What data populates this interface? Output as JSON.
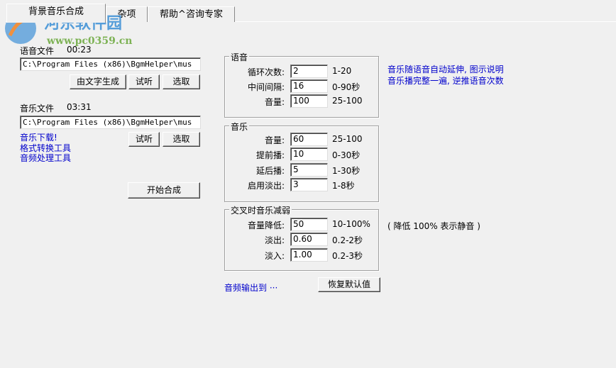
{
  "tabs": [
    {
      "label": "背景音乐合成"
    },
    {
      "label": "杂项"
    },
    {
      "label": "帮助^咨询专家"
    }
  ],
  "watermark": {
    "name": "河东软件园",
    "url": "www.pc0359.cn"
  },
  "voice_file": {
    "label": "语音文件",
    "duration": "00:23",
    "path": "C:\\Program Files (x86)\\BgmHelper\\mus",
    "btn_generate": "由文字生成",
    "btn_listen": "试听",
    "btn_select": "选取"
  },
  "music_file": {
    "label": "音乐文件",
    "duration": "03:31",
    "path": "C:\\Program Files (x86)\\BgmHelper\\mus",
    "btn_listen": "试听",
    "btn_select": "选取",
    "links": [
      "音乐下载!",
      "格式转换工具",
      "音频处理工具"
    ]
  },
  "start_button": "开始合成",
  "voice_group": {
    "title": "语音",
    "rows": [
      {
        "label": "循环次数:",
        "value": "2",
        "range": "1-20"
      },
      {
        "label": "中间间隔:",
        "value": "16",
        "range": "0-90秒"
      },
      {
        "label": "音量:",
        "value": "100",
        "range": "25-100"
      }
    ]
  },
  "music_group": {
    "title": "音乐",
    "rows": [
      {
        "label": "音量:",
        "value": "60",
        "range": "25-100"
      },
      {
        "label": "提前播:",
        "value": "10",
        "range": "0-30秒"
      },
      {
        "label": "延后播:",
        "value": "5",
        "range": "1-30秒"
      },
      {
        "label": "启用淡出:",
        "value": "3",
        "range": "1-8秒"
      }
    ]
  },
  "cross_group": {
    "title": "交叉时音乐减弱",
    "rows": [
      {
        "label": "音量降低:",
        "value": "50",
        "range": "10-100%"
      },
      {
        "label": "淡出:",
        "value": "0.60",
        "range": "0.2-2秒"
      },
      {
        "label": "淡入:",
        "value": "1.00",
        "range": "0.2-3秒"
      }
    ],
    "note": "( 降低 100% 表示静音 )"
  },
  "notes": [
    "音乐随语音自动延伸, 图示说明",
    "音乐播完整一遍, 逆推语音次数"
  ],
  "output_link": "音频输出到 ···",
  "restore_button": "恢复默认值"
}
